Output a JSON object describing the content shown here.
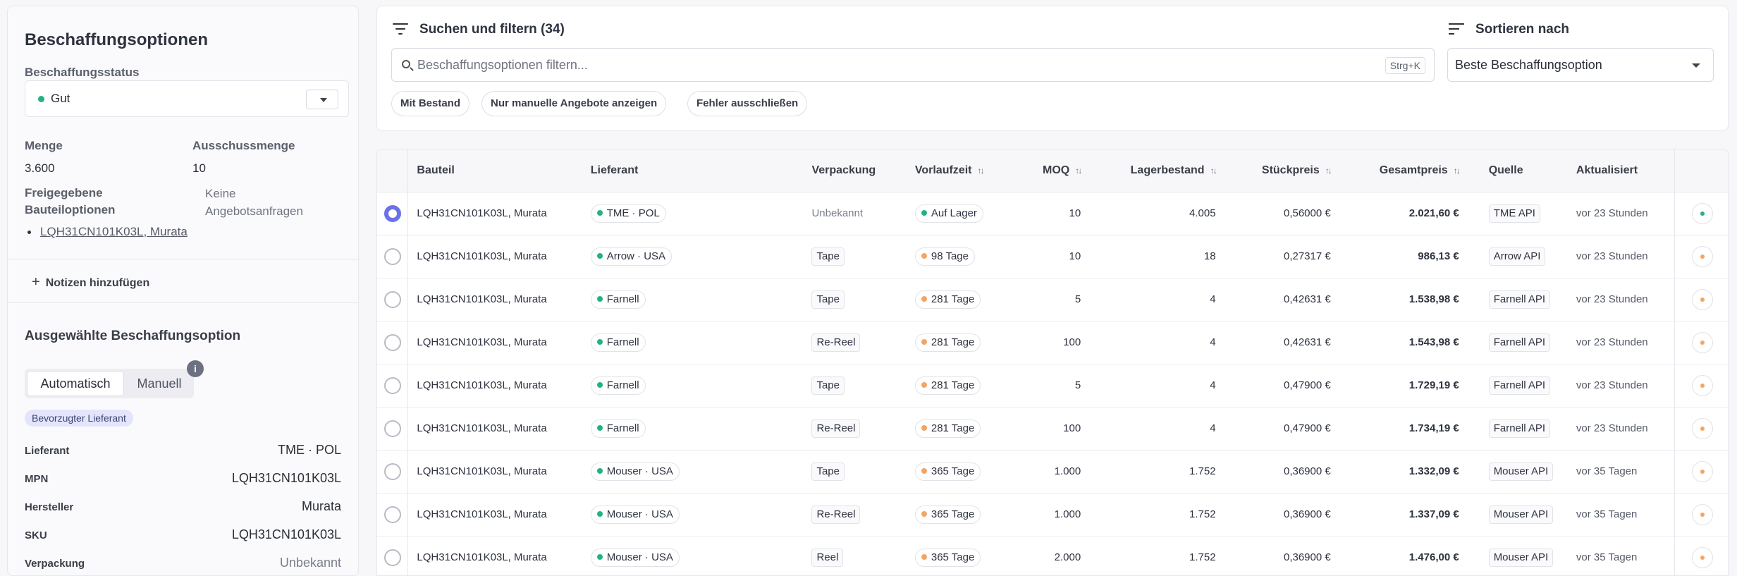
{
  "left": {
    "title": "Beschaffungsoptionen",
    "status_label": "Beschaffungsstatus",
    "status_value": "Gut",
    "qty_label": "Menge",
    "qty_value": "3.600",
    "scrap_label": "Ausschussmenge",
    "scrap_value": "10",
    "approved_label": "Freigegebene Bauteiloptionen",
    "approved_item": "LQH31CN101K03L, Murata",
    "rfq_label": "Keine Angebotsanfragen",
    "notes_label": "Notizen hinzufügen",
    "selected_title": "Ausgewählte Beschaffungsoption",
    "mode_auto": "Automatisch",
    "mode_manual": "Manuell",
    "info_icon": "i",
    "preferred_badge": "Bevorzugter Lieferant",
    "details": [
      {
        "label": "Lieferant",
        "value": "TME · POL"
      },
      {
        "label": "MPN",
        "value": "LQH31CN101K03L"
      },
      {
        "label": "Hersteller",
        "value": "Murata"
      },
      {
        "label": "SKU",
        "value": "LQH31CN101K03L"
      },
      {
        "label": "Verpackung",
        "value": "Unbekannt"
      }
    ]
  },
  "top": {
    "filter_title": "Suchen und filtern (34)",
    "search_placeholder": "Beschaffungsoptionen filtern...",
    "shortcut": "Strg+K",
    "chips": [
      "Mit Bestand",
      "Nur manuelle Angebote anzeigen",
      "Fehler ausschließen"
    ],
    "sort_title": "Sortieren nach",
    "sort_value": "Beste Beschaffungsoption"
  },
  "table": {
    "headers": {
      "part": "Bauteil",
      "supplier": "Lieferant",
      "packaging": "Verpackung",
      "lead": "Vorlaufzeit",
      "moq": "MOQ",
      "stock": "Lagerbestand",
      "unit": "Stückpreis",
      "total": "Gesamtpreis",
      "source": "Quelle",
      "updated": "Aktualisiert"
    },
    "colors": {
      "green": "#22b37e",
      "orange": "#f3a565",
      "accent": "#6a72e6"
    },
    "rows": [
      {
        "part": "LQH31CN101K03L, Murata",
        "supplier": "TME · POL",
        "packaging": "Unbekannt",
        "lead": "Auf Lager",
        "lead_status": "green",
        "moq": "10",
        "stock": "4.005",
        "unit": "0,56000 €",
        "total": "2.021,60 €",
        "source": "TME API",
        "updated": "vor 23 Stunden",
        "selected": true,
        "status": "green"
      },
      {
        "part": "LQH31CN101K03L, Murata",
        "supplier": "Arrow · USA",
        "packaging": "Tape",
        "lead": "98 Tage",
        "lead_status": "orange",
        "moq": "10",
        "stock": "18",
        "unit": "0,27317 €",
        "total": "986,13 €",
        "source": "Arrow API",
        "updated": "vor 23 Stunden",
        "selected": false,
        "status": "orange"
      },
      {
        "part": "LQH31CN101K03L, Murata",
        "supplier": "Farnell",
        "packaging": "Tape",
        "lead": "281 Tage",
        "lead_status": "orange",
        "moq": "5",
        "stock": "4",
        "unit": "0,42631 €",
        "total": "1.538,98 €",
        "source": "Farnell API",
        "updated": "vor 23 Stunden",
        "selected": false,
        "status": "orange"
      },
      {
        "part": "LQH31CN101K03L, Murata",
        "supplier": "Farnell",
        "packaging": "Re-Reel",
        "lead": "281 Tage",
        "lead_status": "orange",
        "moq": "100",
        "stock": "4",
        "unit": "0,42631 €",
        "total": "1.543,98 €",
        "source": "Farnell API",
        "updated": "vor 23 Stunden",
        "selected": false,
        "status": "orange"
      },
      {
        "part": "LQH31CN101K03L, Murata",
        "supplier": "Farnell",
        "packaging": "Tape",
        "lead": "281 Tage",
        "lead_status": "orange",
        "moq": "5",
        "stock": "4",
        "unit": "0,47900 €",
        "total": "1.729,19 €",
        "source": "Farnell API",
        "updated": "vor 23 Stunden",
        "selected": false,
        "status": "orange"
      },
      {
        "part": "LQH31CN101K03L, Murata",
        "supplier": "Farnell",
        "packaging": "Re-Reel",
        "lead": "281 Tage",
        "lead_status": "orange",
        "moq": "100",
        "stock": "4",
        "unit": "0,47900 €",
        "total": "1.734,19 €",
        "source": "Farnell API",
        "updated": "vor 23 Stunden",
        "selected": false,
        "status": "orange"
      },
      {
        "part": "LQH31CN101K03L, Murata",
        "supplier": "Mouser · USA",
        "packaging": "Tape",
        "lead": "365 Tage",
        "lead_status": "orange",
        "moq": "1.000",
        "stock": "1.752",
        "unit": "0,36900 €",
        "total": "1.332,09 €",
        "source": "Mouser API",
        "updated": "vor 35 Tagen",
        "selected": false,
        "status": "orange"
      },
      {
        "part": "LQH31CN101K03L, Murata",
        "supplier": "Mouser · USA",
        "packaging": "Re-Reel",
        "lead": "365 Tage",
        "lead_status": "orange",
        "moq": "1.000",
        "stock": "1.752",
        "unit": "0,36900 €",
        "total": "1.337,09 €",
        "source": "Mouser API",
        "updated": "vor 35 Tagen",
        "selected": false,
        "status": "orange"
      },
      {
        "part": "LQH31CN101K03L, Murata",
        "supplier": "Mouser · USA",
        "packaging": "Reel",
        "lead": "365 Tage",
        "lead_status": "orange",
        "moq": "2.000",
        "stock": "1.752",
        "unit": "0,36900 €",
        "total": "1.476,00 €",
        "source": "Mouser API",
        "updated": "vor 35 Tagen",
        "selected": false,
        "status": "orange"
      }
    ]
  }
}
